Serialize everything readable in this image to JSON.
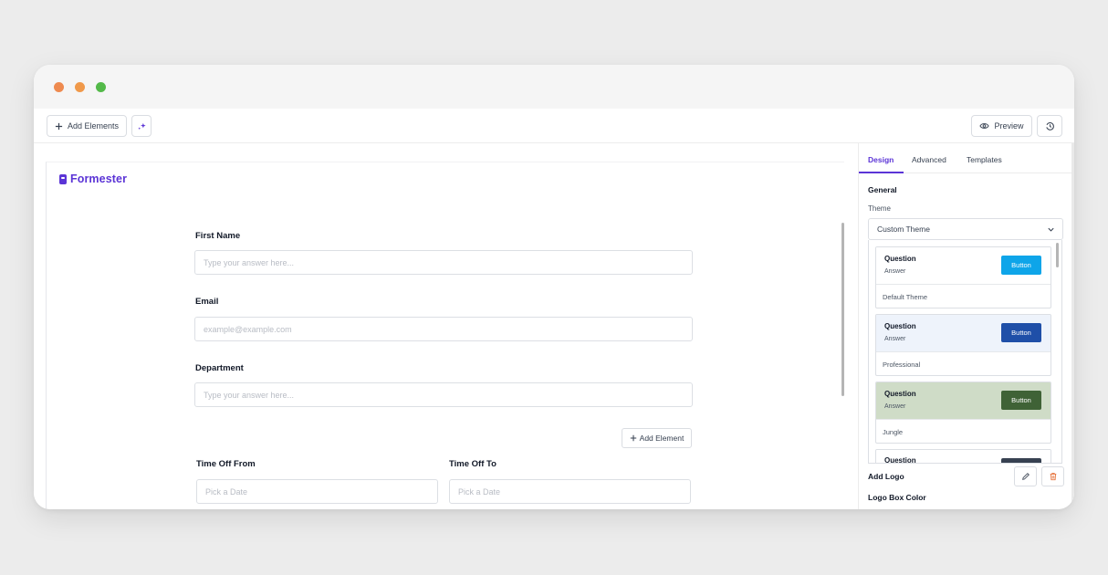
{
  "colors": {
    "brand": "#5b34d6",
    "dot_close": "#ee8a4f",
    "dot_min": "#f0994a",
    "dot_max": "#53b949"
  },
  "toolbar": {
    "add_elements_label": "Add Elements",
    "add_icon": "plus-icon",
    "sparkle_icon": "sparkle-icon",
    "preview_label": "Preview",
    "preview_icon": "eye-icon",
    "history_icon": "history-icon"
  },
  "form": {
    "logo_text": "Formester",
    "fields": {
      "first_name": {
        "label": "First Name",
        "placeholder": "Type your answer here..."
      },
      "email": {
        "label": "Email",
        "placeholder": "example@example.com"
      },
      "department": {
        "label": "Department",
        "placeholder": "Type your answer here..."
      },
      "time_off_from": {
        "label": "Time Off From",
        "placeholder": "Pick a Date"
      },
      "time_off_to": {
        "label": "Time Off To",
        "placeholder": "Pick a Date"
      }
    },
    "add_element_label": "Add Element"
  },
  "panel": {
    "tabs": [
      "Design",
      "Advanced",
      "Templates"
    ],
    "active_tab": "Design",
    "general_heading": "General",
    "theme_label": "Theme",
    "theme_selected": "Custom Theme",
    "themes": [
      {
        "question": "Question",
        "answer": "Answer",
        "button": "Button",
        "name": "Default Theme",
        "bg": "#ffffff",
        "button_color": "#0ea5e9"
      },
      {
        "question": "Question",
        "answer": "Answer",
        "button": "Button",
        "name": "Professional",
        "bg": "#eef3fb",
        "button_color": "#1f4fa8"
      },
      {
        "question": "Question",
        "answer": "Answer",
        "button": "Button",
        "name": "Jungle",
        "bg": "#cfdcc7",
        "button_color": "#3f6236"
      },
      {
        "question": "Question",
        "answer": "",
        "button": "",
        "name": "",
        "bg": "#ffffff",
        "button_color": "#374151"
      }
    ],
    "add_logo_label": "Add Logo",
    "logo_box_color_label": "Logo Box Color"
  }
}
